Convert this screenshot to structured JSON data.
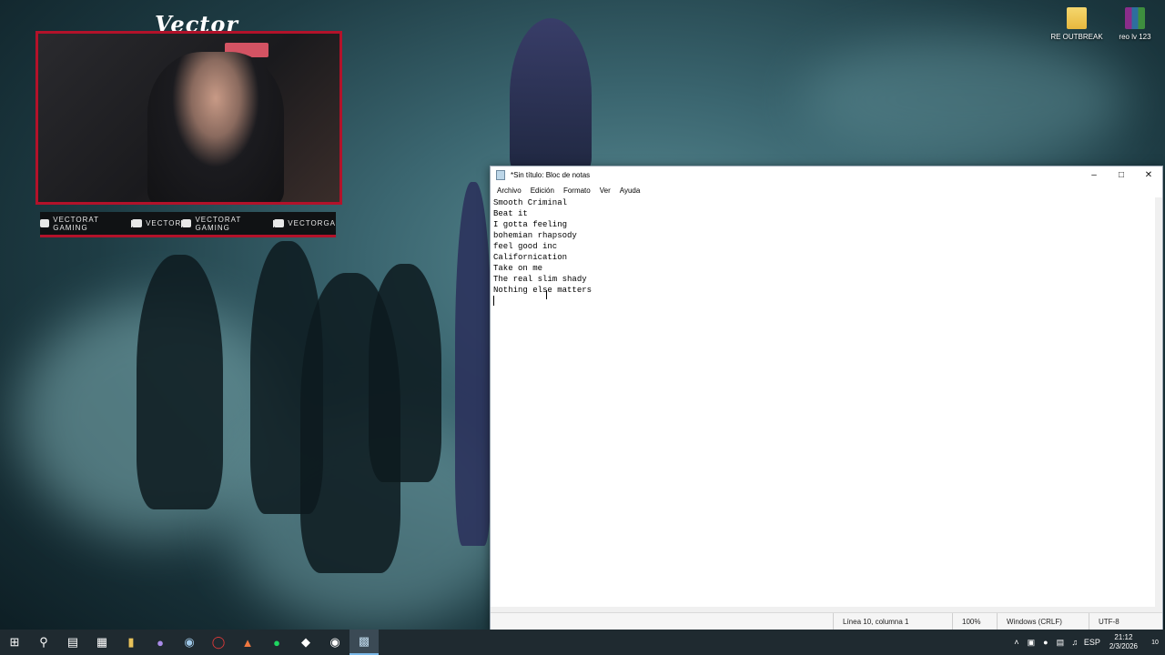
{
  "overlay": {
    "streamer_name": "Vector",
    "socials": [
      {
        "icon": "youtube-icon",
        "label": "VECTORAT GAMING"
      },
      {
        "icon": "twitch-icon",
        "label": "VECTOR"
      },
      {
        "icon": "twitter-icon",
        "label": "VECTORAT GAMING"
      },
      {
        "icon": "instagram-icon",
        "label": "VECTORGA"
      }
    ]
  },
  "desktop": {
    "icons": [
      {
        "label": "RE OUTBREAK",
        "icon": "folder-icon"
      },
      {
        "label": "reo lv 123",
        "icon": "winrar-archive-icon"
      }
    ]
  },
  "notepad": {
    "title": "*Sin título: Bloc de notas",
    "menu": [
      "Archivo",
      "Edición",
      "Formato",
      "Ver",
      "Ayuda"
    ],
    "lines": [
      "Smooth Criminal",
      "Beat it",
      "I gotta feeling",
      "bohemian rhapsody",
      "feel good inc",
      "Californication",
      "Take on me",
      "The real slim shady",
      "Nothing else matters"
    ],
    "status": {
      "position": "Línea 10, columna 1",
      "zoom": "100%",
      "line_ending": "Windows (CRLF)",
      "encoding": "UTF-8"
    }
  },
  "taskbar": {
    "tray": {
      "language": "ESP",
      "time": "21:12",
      "date": "2/3/2026",
      "notification_count": "10"
    }
  }
}
